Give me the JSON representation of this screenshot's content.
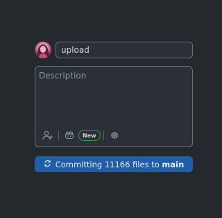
{
  "commit": {
    "summary_value": "upload",
    "description_placeholder": "Description",
    "toolbar": {
      "add_coauthor_icon": "person-add-icon",
      "copilot_icon": "copilot-icon",
      "new_badge": "New",
      "settings_icon": "gear-icon"
    },
    "button": {
      "prefix": "Committing 11166 files to",
      "branch": "main",
      "icon": "sync-icon"
    }
  },
  "colors": {
    "background": "#24292e",
    "button": "#1f5ea8",
    "badge_border": "#2ea043",
    "input_border": "#6a737d"
  }
}
